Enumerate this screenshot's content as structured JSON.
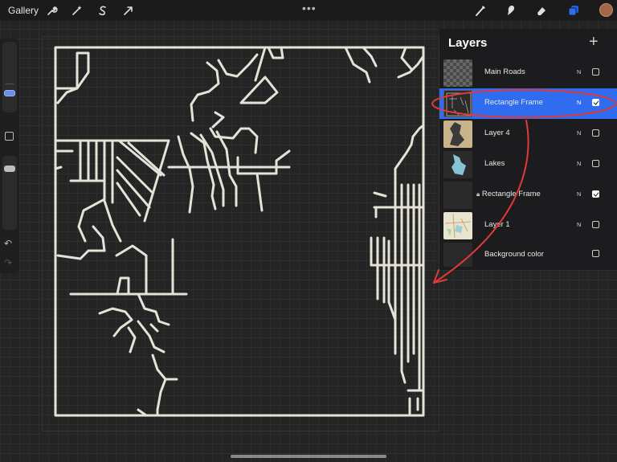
{
  "topbar": {
    "gallery_label": "Gallery",
    "tools_left": [
      "wrench-icon",
      "magic-wand-icon",
      "selection-icon",
      "transform-arrow-icon"
    ],
    "more_dots": "•••",
    "tools_right": [
      "brush-icon",
      "smudge-icon",
      "eraser-icon",
      "layers-icon"
    ],
    "accent_color": "#2f6cf0",
    "avatar_color": "#a0674a"
  },
  "sidebar": {
    "undo_glyph": "↶",
    "redo_glyph": "↷"
  },
  "layers_panel": {
    "title": "Layers",
    "add_glyph": "+",
    "layers": [
      {
        "name": "Main Roads",
        "blend": "N",
        "visible": false,
        "selected": false,
        "locked": false,
        "thumb": "checker"
      },
      {
        "name": "Rectangle Frame",
        "blend": "N",
        "visible": true,
        "selected": true,
        "locked": false,
        "thumb": "map-dark"
      },
      {
        "name": "Layer 4",
        "blend": "N",
        "visible": false,
        "selected": false,
        "locked": false,
        "thumb": "tan"
      },
      {
        "name": "Lakes",
        "blend": "N",
        "visible": false,
        "selected": false,
        "locked": false,
        "thumb": "lakes"
      },
      {
        "name": "Rectangle Frame",
        "blend": "N",
        "visible": true,
        "selected": false,
        "locked": true,
        "thumb": "empty"
      },
      {
        "name": "Layer 1",
        "blend": "N",
        "visible": false,
        "selected": false,
        "locked": false,
        "thumb": "map-light"
      },
      {
        "name": "Background color",
        "blend": "",
        "visible": false,
        "selected": false,
        "locked": false,
        "thumb": "none"
      }
    ]
  },
  "annotation_color": "#e03a3a"
}
